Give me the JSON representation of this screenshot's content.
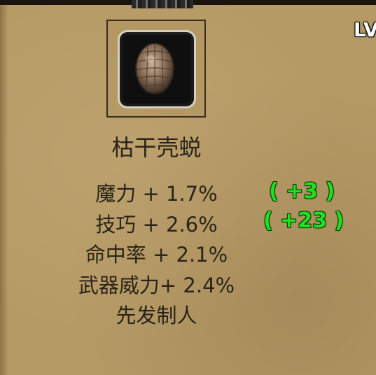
{
  "hud": {
    "level_label": "LV"
  },
  "item": {
    "icon": "turtle-shell-icon",
    "name": "枯干壳蜕",
    "stats": [
      {
        "text": "魔力 + 1.7%",
        "bonus": "( +3 )"
      },
      {
        "text": "技巧 + 2.6%",
        "bonus": "( +23 )"
      },
      {
        "text": "命中率 + 2.1%"
      },
      {
        "text": "武器威力+ 2.4%"
      },
      {
        "text": "先发制人"
      }
    ]
  },
  "colors": {
    "parchment": "#b69a66",
    "text": "#2a2418",
    "bonus": "#1ee21e",
    "slot_border": "#d6d0c2"
  }
}
